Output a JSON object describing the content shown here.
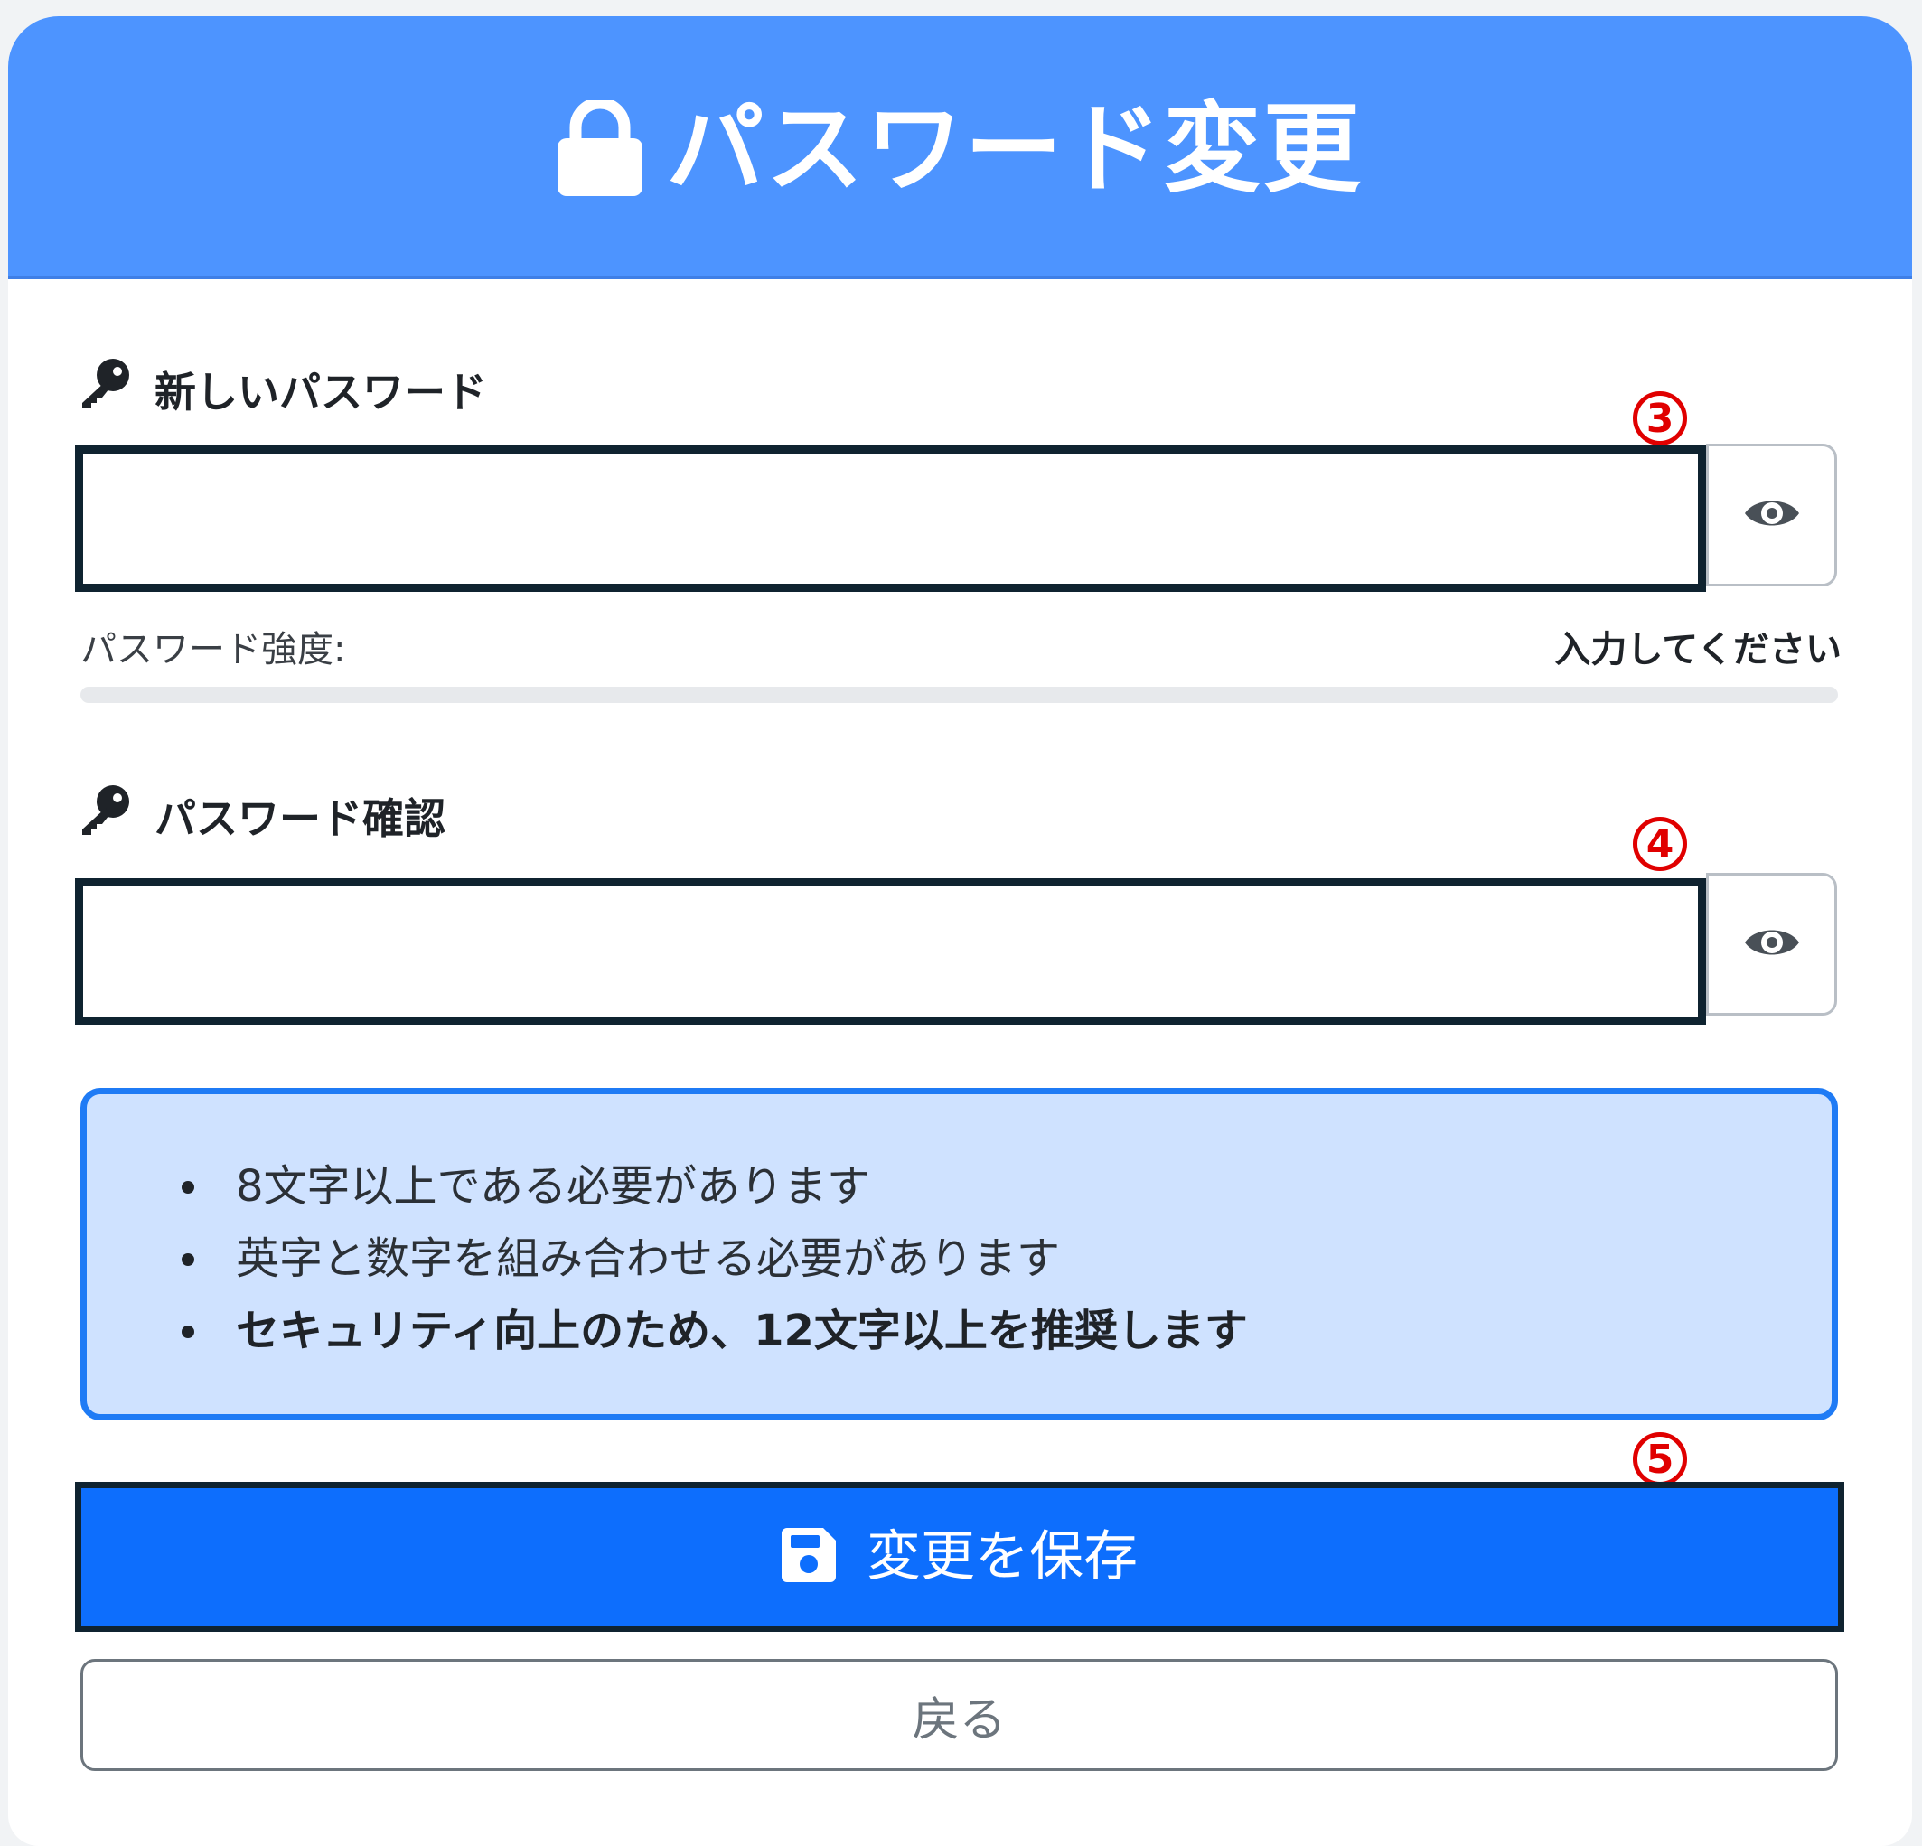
{
  "header": {
    "title": "パスワード変更",
    "icon": "lock-icon"
  },
  "new_password": {
    "label": "新しいパスワード",
    "icon": "key-icon",
    "value": "",
    "placeholder": "",
    "toggle_icon": "eye-icon",
    "marker": "3"
  },
  "strength": {
    "label": "パスワード強度:",
    "status": "入力してください",
    "level": 0
  },
  "confirm_password": {
    "label": "パスワード確認",
    "icon": "key-icon",
    "value": "",
    "placeholder": "",
    "toggle_icon": "eye-icon",
    "marker": "4"
  },
  "requirements": [
    "8文字以上である必要があります",
    "英字と数字を組み合わせる必要があります",
    "セキュリティ向上のため、12文字以上を推奨します"
  ],
  "save": {
    "label": "変更を保存",
    "icon": "save-icon",
    "marker": "5"
  },
  "back": {
    "label": "戻る"
  },
  "colors": {
    "header_bg": "#4d94ff",
    "primary": "#0d6efd",
    "info_bg": "#cfe2ff",
    "annotation": "#e00000",
    "highlight_border": "#0f2330"
  }
}
